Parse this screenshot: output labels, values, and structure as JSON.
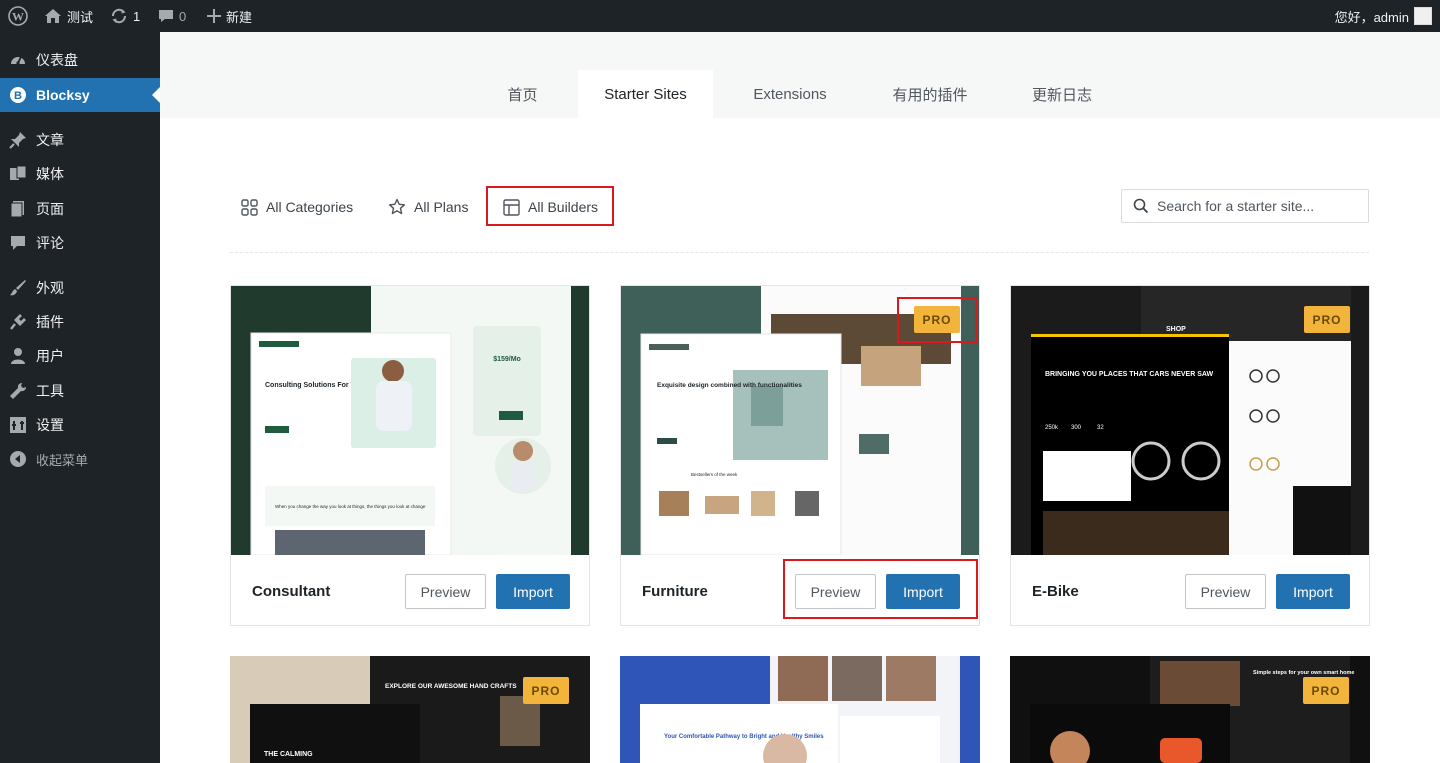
{
  "adminbar": {
    "site_name": "测试",
    "updates_count": "1",
    "comments_count": "0",
    "new_label": "新建",
    "greeting": "您好，admin"
  },
  "sidebar": {
    "items": [
      {
        "label": "仪表盘",
        "icon": "dashboard-icon"
      },
      {
        "label": "Blocksy",
        "icon": "blocksy-icon",
        "active": true
      },
      {
        "label": "文章",
        "icon": "pin-icon"
      },
      {
        "label": "媒体",
        "icon": "media-icon"
      },
      {
        "label": "页面",
        "icon": "page-icon"
      },
      {
        "label": "评论",
        "icon": "comment-icon"
      },
      {
        "label": "外观",
        "icon": "brush-icon"
      },
      {
        "label": "插件",
        "icon": "plugin-icon"
      },
      {
        "label": "用户",
        "icon": "user-icon"
      },
      {
        "label": "工具",
        "icon": "wrench-icon"
      },
      {
        "label": "设置",
        "icon": "settings-icon"
      },
      {
        "label": "收起菜单",
        "icon": "collapse-icon"
      }
    ]
  },
  "tabs": [
    {
      "label": "首页"
    },
    {
      "label": "Starter Sites",
      "active": true
    },
    {
      "label": "Extensions"
    },
    {
      "label": "有用的插件"
    },
    {
      "label": "更新日志"
    }
  ],
  "filters": {
    "categories": "All Categories",
    "plans": "All Plans",
    "builders": "All Builders"
  },
  "search": {
    "placeholder": "Search for a starter site..."
  },
  "sites": [
    {
      "name": "Consultant",
      "pro": false,
      "preview": "Preview",
      "import": "Import"
    },
    {
      "name": "Furniture",
      "pro": true,
      "preview": "Preview",
      "import": "Import"
    },
    {
      "name": "E-Bike",
      "pro": true,
      "preview": "Preview",
      "import": "Import"
    }
  ],
  "thumb_text": {
    "consultant_headline": "Consulting Solutions For Your Business",
    "consultant_price": "$159/Mo",
    "consultant_sub": "When you change the way you look at things, the things you look at change",
    "furniture_headline": "Exquisite design combined with functionalities",
    "furniture_section": "Bestsellers of the week",
    "ebike_headline": "BRINGING YOU PLACES THAT CARS NEVER SAW",
    "ebike_stats": [
      "250k",
      "300",
      "32"
    ],
    "ebike_shop": "SHOP",
    "row2_a_headline": "EXPLORE OUR AWESOME HAND CRAFTS",
    "row2_a_sub": "THE CALMING",
    "row2_b_headline": "Your Comfortable Pathway to Bright and Healthy Smiles",
    "row2_c_headline": "Simple steps for your own smart home"
  },
  "pro_label": "PRO",
  "colors": {
    "accent": "#2271b1",
    "pro": "#f2b43b",
    "highlight": "#d9191e",
    "admin_dark": "#1d2327"
  }
}
